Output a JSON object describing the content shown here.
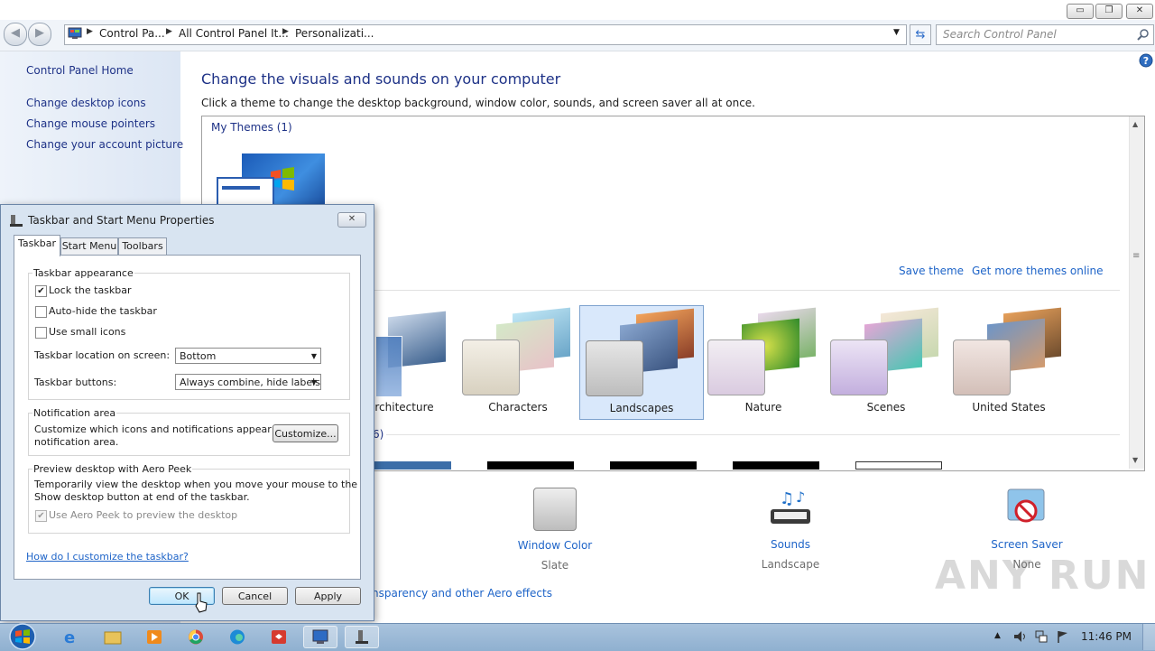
{
  "window": {
    "breadcrumbs": [
      "Control Pa...",
      "All Control Panel It...",
      "Personalizati..."
    ],
    "search_placeholder": "Search Control Panel",
    "caption": {
      "minimize": "▭",
      "restore": "❐",
      "close": "✕"
    }
  },
  "leftnav": {
    "home": "Control Panel Home",
    "links": [
      "Change desktop icons",
      "Change mouse pointers",
      "Change your account picture"
    ]
  },
  "main": {
    "title": "Change the visuals and sounds on your computer",
    "subtitle": "Click a theme to change the desktop background, window color, sounds, and screen saver all at once.",
    "my_themes": "My Themes (1)",
    "save_theme": "Save theme",
    "get_more": "Get more themes online",
    "aero_group_partial": "6)",
    "themes": [
      {
        "label": "rchitecture",
        "selected": false
      },
      {
        "label": "Characters",
        "selected": false
      },
      {
        "label": "Landscapes",
        "selected": true
      },
      {
        "label": "Nature",
        "selected": false
      },
      {
        "label": "Scenes",
        "selected": false
      },
      {
        "label": "United States",
        "selected": false
      }
    ],
    "bottom": {
      "window_color": {
        "name": "Window Color",
        "value": "Slate"
      },
      "sounds": {
        "name": "Sounds",
        "value": "Landscape"
      },
      "screen_saver": {
        "name": "Screen Saver",
        "value": "None"
      },
      "aero_link": "nsparency and other Aero effects"
    }
  },
  "dialog": {
    "title": "Taskbar and Start Menu Properties",
    "tabs": [
      "Taskbar",
      "Start Menu",
      "Toolbars"
    ],
    "appearance": {
      "legend": "Taskbar appearance",
      "lock": {
        "label": "Lock the taskbar",
        "checked": true
      },
      "autohide": {
        "label": "Auto-hide the taskbar",
        "checked": false
      },
      "small_icons": {
        "label": "Use small icons",
        "checked": false
      },
      "location_label": "Taskbar location on screen:",
      "location_value": "Bottom",
      "buttons_label": "Taskbar buttons:",
      "buttons_value": "Always combine, hide labels"
    },
    "notification": {
      "legend": "Notification area",
      "text_line1": "Customize which icons and notifications appear in the",
      "text_line2": "notification area.",
      "button": "Customize..."
    },
    "peek": {
      "legend": "Preview desktop with Aero Peek",
      "text_line1": "Temporarily view the desktop when you move your mouse to the",
      "text_line2": "Show desktop button at end of the taskbar.",
      "checkbox": {
        "label": "Use Aero Peek to preview the desktop",
        "checked": true
      }
    },
    "help_link": "How do I customize the taskbar?",
    "buttons": {
      "ok": "OK",
      "cancel": "Cancel",
      "apply": "Apply"
    }
  },
  "taskbar": {
    "clock": "11:46 PM",
    "watermark": "ANY RUN"
  }
}
